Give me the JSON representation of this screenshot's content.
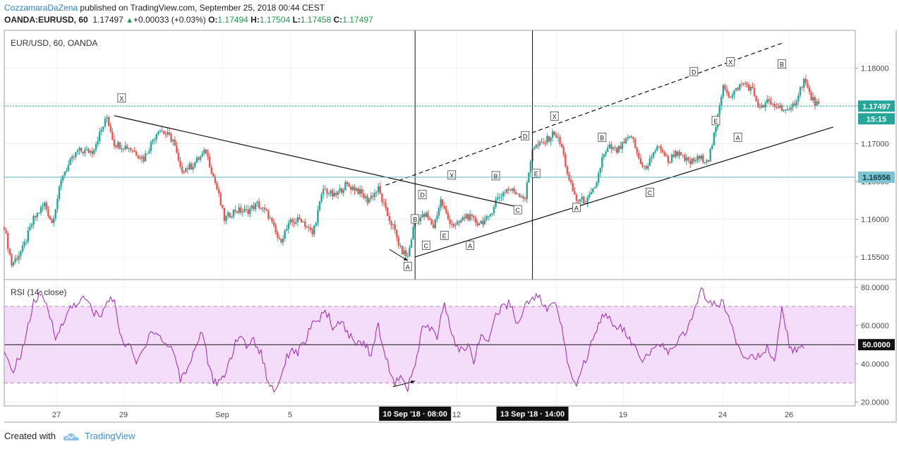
{
  "header": {
    "author": "CozzamaraDaZena",
    "published_text": "published on TradingView.com, September 25, 2018 00:44 CEST",
    "symbol": "OANDA:EURUSD, 60",
    "price": "1.17497",
    "change": "+0.00033 (+0.03%)",
    "o_label": "O:",
    "o_value": "1.17494",
    "h_label": "H:",
    "h_value": "1.17504",
    "l_label": "L:",
    "l_value": "1.17458",
    "c_label": "C:",
    "c_value": "1.17497"
  },
  "footer": {
    "created_with": "Created with",
    "brand": "TradingView"
  },
  "colors": {
    "up": "#26a69a",
    "down": "#ef5350",
    "rsi": "#9c27b0",
    "rsi_band": "#f3ddfa",
    "last_price": "#26a69a",
    "support_line": "#5fb5c6",
    "axis_text": "#4a4a4a"
  },
  "chart_data": [
    {
      "type": "candlestick",
      "title": "EUR/USD, 60, OANDA",
      "ylim": [
        1.152,
        1.185
      ],
      "y_ticks": [
        "1.18000",
        "1.17500",
        "1.17000",
        "1.16500",
        "1.16000",
        "1.15500"
      ],
      "x_tick_labels": [
        "27",
        "29",
        "Sep",
        "5",
        "12",
        "17",
        "19",
        "24",
        "26"
      ],
      "x_highlight_labels": [
        "10 Sep '18 · 08:00",
        "13 Sep '18 · 14:00"
      ],
      "close_path": [
        [
          0,
          1.159
        ],
        [
          2,
          1.154
        ],
        [
          5,
          1.156
        ],
        [
          8,
          1.16
        ],
        [
          11,
          1.162
        ],
        [
          13,
          1.1595
        ],
        [
          16,
          1.166
        ],
        [
          20,
          1.169
        ],
        [
          24,
          1.169
        ],
        [
          28,
          1.1735
        ],
        [
          30,
          1.17
        ],
        [
          34,
          1.1695
        ],
        [
          38,
          1.168
        ],
        [
          42,
          1.172
        ],
        [
          46,
          1.1705
        ],
        [
          48,
          1.1665
        ],
        [
          51,
          1.167
        ],
        [
          55,
          1.169
        ],
        [
          58,
          1.164
        ],
        [
          60,
          1.16
        ],
        [
          63,
          1.1612
        ],
        [
          66,
          1.161
        ],
        [
          69,
          1.162
        ],
        [
          72,
          1.1605
        ],
        [
          75,
          1.157
        ],
        [
          78,
          1.1595
        ],
        [
          81,
          1.16
        ],
        [
          84,
          1.158
        ],
        [
          87,
          1.164
        ],
        [
          90,
          1.163
        ],
        [
          93,
          1.1645
        ],
        [
          96,
          1.164
        ],
        [
          99,
          1.1625
        ],
        [
          102,
          1.164
        ],
        [
          104,
          1.161
        ],
        [
          106,
          1.159
        ],
        [
          108,
          1.156
        ],
        [
          110,
          1.155
        ],
        [
          112,
          1.16
        ],
        [
          115,
          1.1605
        ],
        [
          117,
          1.159
        ],
        [
          119,
          1.1625
        ],
        [
          121,
          1.16
        ],
        [
          123,
          1.159
        ],
        [
          126,
          1.1605
        ],
        [
          129,
          1.1595
        ],
        [
          132,
          1.16
        ],
        [
          134,
          1.1625
        ],
        [
          137,
          1.164
        ],
        [
          140,
          1.1635
        ],
        [
          142,
          1.1628
        ],
        [
          144,
          1.1695
        ],
        [
          147,
          1.17
        ],
        [
          150,
          1.1715
        ],
        [
          152,
          1.1695
        ],
        [
          154,
          1.165
        ],
        [
          156,
          1.1625
        ],
        [
          159,
          1.1625
        ],
        [
          161,
          1.164
        ],
        [
          163,
          1.168
        ],
        [
          165,
          1.1695
        ],
        [
          167,
          1.169
        ],
        [
          169,
          1.17
        ],
        [
          171,
          1.171
        ],
        [
          173,
          1.168
        ],
        [
          175,
          1.1665
        ],
        [
          177,
          1.169
        ],
        [
          179,
          1.1695
        ],
        [
          181,
          1.1675
        ],
        [
          183,
          1.169
        ],
        [
          185,
          1.168
        ],
        [
          187,
          1.1675
        ],
        [
          189,
          1.168
        ],
        [
          192,
          1.168
        ],
        [
          194,
          1.172
        ],
        [
          196,
          1.178
        ],
        [
          198,
          1.176
        ],
        [
          200,
          1.1775
        ],
        [
          202,
          1.178
        ],
        [
          204,
          1.177
        ],
        [
          206,
          1.1745
        ],
        [
          208,
          1.1755
        ],
        [
          210,
          1.175
        ],
        [
          212,
          1.1748
        ],
        [
          214,
          1.174
        ],
        [
          216,
          1.176
        ],
        [
          218,
          1.1785
        ],
        [
          220,
          1.176
        ],
        [
          222,
          1.175
        ]
      ],
      "last_price": 1.17497,
      "last_price_label": "1.17497",
      "countdown_label": "15:15",
      "support_level": 1.16556,
      "support_label": "1.16556",
      "trend_lines": [
        {
          "style": "solid",
          "from": [
            30,
            1.1737
          ],
          "to": [
            141,
            1.1615
          ]
        },
        {
          "style": "solid",
          "from": [
            112,
            1.155
          ],
          "to": [
            226,
            1.1722
          ]
        },
        {
          "style": "dashed",
          "from": [
            104,
            1.1645
          ],
          "to": [
            212,
            1.1833
          ]
        }
      ],
      "vertical_markers": [
        112,
        144
      ],
      "wave_labels": [
        {
          "text": "X",
          "t": 32,
          "p": 1.176
        },
        {
          "text": "A",
          "t": 110,
          "p": 1.1537
        },
        {
          "text": "B",
          "t": 112,
          "p": 1.16
        },
        {
          "text": "C",
          "t": 115,
          "p": 1.1565
        },
        {
          "text": "D",
          "t": 114,
          "p": 1.1632
        },
        {
          "text": "E",
          "t": 120,
          "p": 1.1578
        },
        {
          "text": "X",
          "t": 122,
          "p": 1.1658
        },
        {
          "text": "A",
          "t": 127,
          "p": 1.1565
        },
        {
          "text": "B",
          "t": 134,
          "p": 1.1657
        },
        {
          "text": "C",
          "t": 140,
          "p": 1.1612
        },
        {
          "text": "D",
          "t": 142,
          "p": 1.171
        },
        {
          "text": "E",
          "t": 145,
          "p": 1.166
        },
        {
          "text": "X",
          "t": 150,
          "p": 1.1736
        },
        {
          "text": "A",
          "t": 156,
          "p": 1.1615
        },
        {
          "text": "B",
          "t": 163,
          "p": 1.1708
        },
        {
          "text": "C",
          "t": 176,
          "p": 1.1635
        },
        {
          "text": "D",
          "t": 188,
          "p": 1.1795
        },
        {
          "text": "E",
          "t": 194,
          "p": 1.173
        },
        {
          "text": "X",
          "t": 198,
          "p": 1.1808
        },
        {
          "text": "A",
          "t": 200,
          "p": 1.1708
        },
        {
          "text": "B",
          "t": 212,
          "p": 1.1805
        }
      ],
      "arrows": [
        {
          "from": [
            105,
            1.156
          ],
          "to": [
            110,
            1.1545
          ]
        }
      ]
    },
    {
      "type": "line",
      "title": "RSI (14, close)",
      "ylim": [
        18,
        84
      ],
      "y_ticks": [
        "80.0000",
        "60.0000",
        "40.0000",
        "20.0000"
      ],
      "band": [
        30,
        70
      ],
      "mid_level": 50,
      "mid_label": "50.0000",
      "series_path": [
        [
          0,
          45
        ],
        [
          2,
          36
        ],
        [
          4,
          42
        ],
        [
          6,
          55
        ],
        [
          8,
          72
        ],
        [
          10,
          76
        ],
        [
          12,
          68
        ],
        [
          14,
          55
        ],
        [
          16,
          60
        ],
        [
          18,
          70
        ],
        [
          20,
          72
        ],
        [
          22,
          74
        ],
        [
          24,
          68
        ],
        [
          26,
          64
        ],
        [
          28,
          72
        ],
        [
          30,
          74
        ],
        [
          32,
          52
        ],
        [
          34,
          50
        ],
        [
          36,
          40
        ],
        [
          38,
          48
        ],
        [
          40,
          58
        ],
        [
          42,
          55
        ],
        [
          44,
          50
        ],
        [
          46,
          48
        ],
        [
          48,
          32
        ],
        [
          50,
          38
        ],
        [
          52,
          48
        ],
        [
          54,
          58
        ],
        [
          56,
          36
        ],
        [
          58,
          28
        ],
        [
          60,
          34
        ],
        [
          62,
          45
        ],
        [
          64,
          55
        ],
        [
          66,
          50
        ],
        [
          68,
          52
        ],
        [
          70,
          46
        ],
        [
          72,
          30
        ],
        [
          74,
          26
        ],
        [
          76,
          38
        ],
        [
          78,
          48
        ],
        [
          80,
          46
        ],
        [
          82,
          52
        ],
        [
          84,
          60
        ],
        [
          86,
          64
        ],
        [
          88,
          66
        ],
        [
          90,
          58
        ],
        [
          92,
          62
        ],
        [
          94,
          55
        ],
        [
          96,
          50
        ],
        [
          98,
          52
        ],
        [
          100,
          45
        ],
        [
          102,
          60
        ],
        [
          104,
          44
        ],
        [
          106,
          30
        ],
        [
          108,
          32
        ],
        [
          110,
          28
        ],
        [
          112,
          38
        ],
        [
          114,
          60
        ],
        [
          116,
          58
        ],
        [
          118,
          54
        ],
        [
          120,
          72
        ],
        [
          122,
          55
        ],
        [
          124,
          46
        ],
        [
          126,
          50
        ],
        [
          128,
          42
        ],
        [
          130,
          55
        ],
        [
          132,
          52
        ],
        [
          134,
          66
        ],
        [
          136,
          70
        ],
        [
          138,
          72
        ],
        [
          140,
          60
        ],
        [
          142,
          70
        ],
        [
          144,
          76
        ],
        [
          146,
          74
        ],
        [
          148,
          68
        ],
        [
          150,
          72
        ],
        [
          152,
          60
        ],
        [
          154,
          36
        ],
        [
          156,
          30
        ],
        [
          158,
          40
        ],
        [
          160,
          50
        ],
        [
          162,
          62
        ],
        [
          164,
          68
        ],
        [
          166,
          58
        ],
        [
          168,
          60
        ],
        [
          170,
          54
        ],
        [
          172,
          48
        ],
        [
          174,
          40
        ],
        [
          176,
          46
        ],
        [
          178,
          52
        ],
        [
          180,
          48
        ],
        [
          182,
          46
        ],
        [
          184,
          52
        ],
        [
          186,
          58
        ],
        [
          188,
          66
        ],
        [
          190,
          80
        ],
        [
          192,
          72
        ],
        [
          194,
          70
        ],
        [
          196,
          72
        ],
        [
          198,
          62
        ],
        [
          200,
          50
        ],
        [
          202,
          44
        ],
        [
          204,
          46
        ],
        [
          206,
          42
        ],
        [
          208,
          48
        ],
        [
          210,
          42
        ],
        [
          212,
          68
        ],
        [
          214,
          50
        ],
        [
          216,
          46
        ],
        [
          218,
          48
        ]
      ],
      "arrows": [
        {
          "from": [
            106,
            28
          ],
          "to": [
            112,
            31
          ]
        }
      ]
    }
  ]
}
